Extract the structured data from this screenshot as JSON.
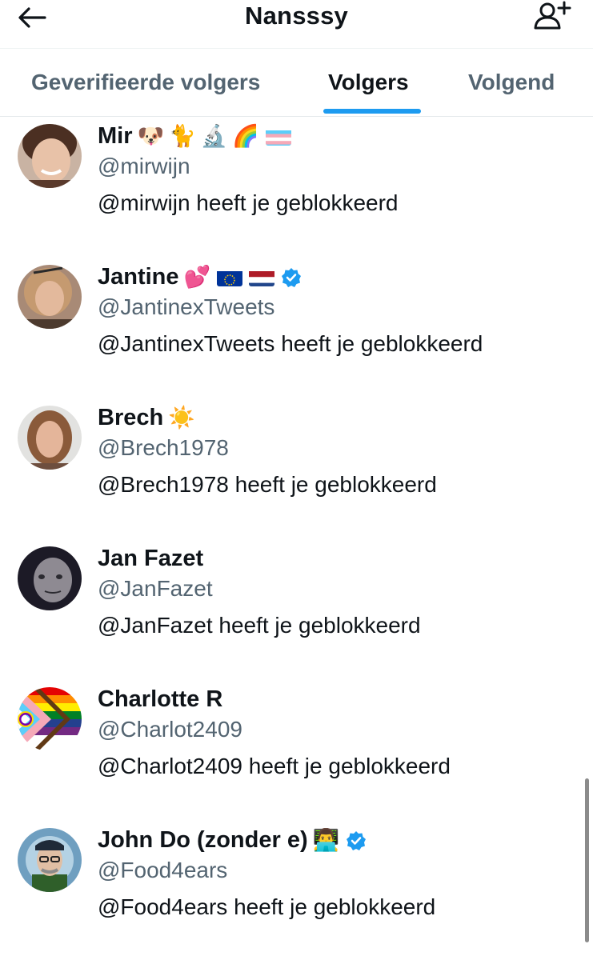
{
  "header": {
    "title": "Nansssy",
    "back_icon": "arrow-left-icon",
    "follow_icon": "person-plus-icon"
  },
  "tabs": [
    {
      "label": "Geverifieerde volgers",
      "active": false
    },
    {
      "label": "Volgers",
      "active": true
    },
    {
      "label": "Volgend",
      "active": false
    }
  ],
  "colors": {
    "accent": "#1d9bf0",
    "secondary_text": "#536471",
    "primary_text": "#0f1419"
  },
  "users": [
    {
      "name": "Mir",
      "emojis": [
        "🐶",
        "🐈",
        "🔬",
        "🌈"
      ],
      "flags": [
        "transgender-flag"
      ],
      "verified": false,
      "handle": "@mirwijn",
      "status": "@mirwijn heeft je geblokkeerd"
    },
    {
      "name": "Jantine",
      "emojis": [
        "💕"
      ],
      "flags": [
        "eu-flag",
        "nl-flag"
      ],
      "verified": true,
      "handle": "@JantinexTweets",
      "status": "@JantinexTweets heeft je geblokkeerd"
    },
    {
      "name": "Brech",
      "emojis": [
        "☀️"
      ],
      "flags": [],
      "verified": false,
      "handle": "@Brech1978",
      "status": "@Brech1978 heeft je geblokkeerd"
    },
    {
      "name": "Jan Fazet",
      "emojis": [],
      "flags": [],
      "verified": false,
      "handle": "@JanFazet",
      "status": "@JanFazet heeft je geblokkeerd"
    },
    {
      "name": "Charlotte R",
      "emojis": [],
      "flags": [],
      "verified": false,
      "handle": "@Charlot2409",
      "status": "@Charlot2409 heeft je geblokkeerd"
    },
    {
      "name": "John Do (zonder e)",
      "emojis": [
        "👨‍💻"
      ],
      "flags": [],
      "verified": true,
      "handle": "@Food4ears",
      "status": "@Food4ears heeft je geblokkeerd"
    }
  ]
}
